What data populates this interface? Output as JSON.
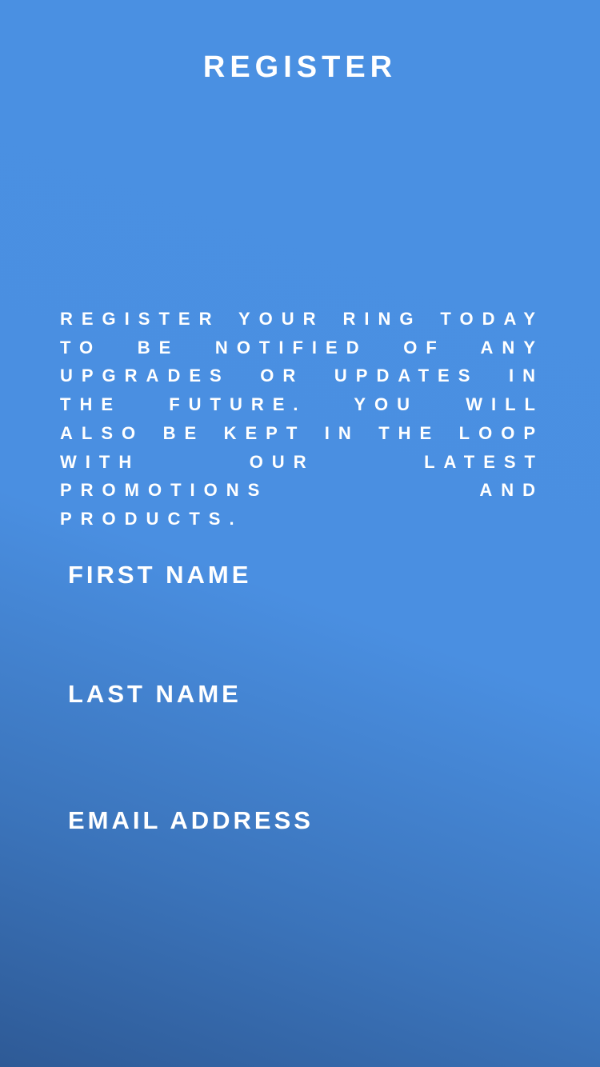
{
  "header": {
    "title": "REGISTER"
  },
  "intro": {
    "text": "REGISTER YOUR RING TODAY TO BE NOTIFIED OF ANY UPGRADES OR UPDATES IN THE FUTURE. YOU WILL ALSO BE KEPT IN THE LOOP WITH OUR LATEST PROMOTIONS AND PRODUCTS."
  },
  "form": {
    "first_name_label": "FIRST NAME",
    "last_name_label": "LAST NAME",
    "email_label": "EMAIL ADDRESS"
  },
  "colors": {
    "background_top": "#4a90e2",
    "background_bottom": "#2e5a96",
    "text": "#ffffff"
  }
}
